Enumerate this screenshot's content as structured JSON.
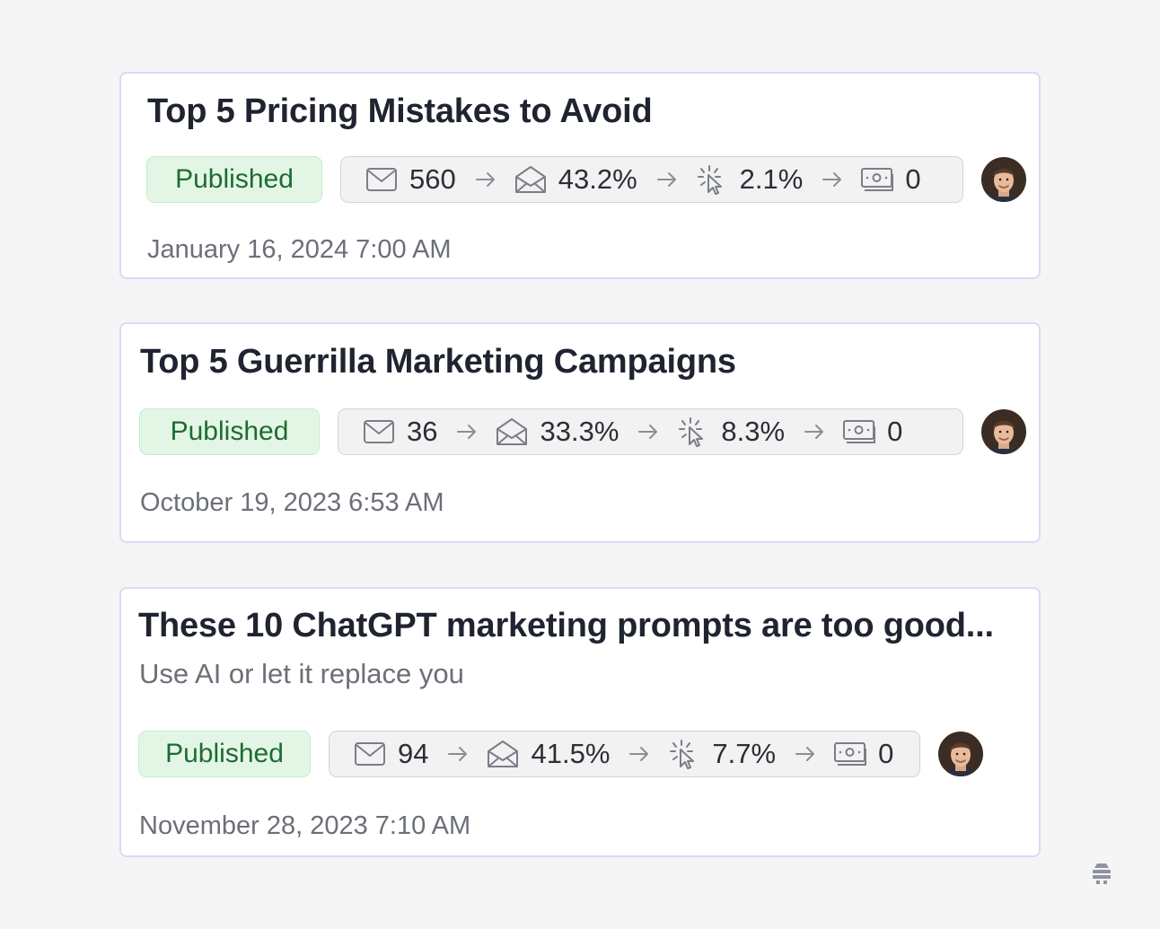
{
  "posts": [
    {
      "title": "Top 5 Pricing Mistakes to Avoid",
      "subtitle": "",
      "status": "Published",
      "stats": {
        "sent": "560",
        "open_rate": "43.2%",
        "click_rate": "2.1%",
        "revenue": "0"
      },
      "date": "January 16, 2024 7:00 AM"
    },
    {
      "title": "Top 5 Guerrilla Marketing Campaigns",
      "subtitle": "",
      "status": "Published",
      "stats": {
        "sent": "36",
        "open_rate": "33.3%",
        "click_rate": "8.3%",
        "revenue": "0"
      },
      "date": "October 19, 2023 6:53 AM"
    },
    {
      "title": "These 10 ChatGPT marketing prompts are too good...",
      "subtitle": "Use AI or let it replace you",
      "status": "Published",
      "stats": {
        "sent": "94",
        "open_rate": "41.5%",
        "click_rate": "7.7%",
        "revenue": "0"
      },
      "date": "November 28, 2023 7:10 AM"
    }
  ],
  "icons": {
    "sent": "envelope-icon",
    "opened": "open-envelope-icon",
    "clicked": "cursor-click-icon",
    "revenue": "money-icon",
    "arrow": "arrow-right-icon",
    "avatar": "author-avatar",
    "corner": "beehiiv-logo-icon"
  },
  "colors": {
    "page_background": "#f5f5f6",
    "card_border": "#dcd8f5",
    "badge_background": "#e3f6e6",
    "badge_text": "#1f6b32",
    "stats_background": "#f2f2f3",
    "muted_text": "#6b6f78"
  }
}
